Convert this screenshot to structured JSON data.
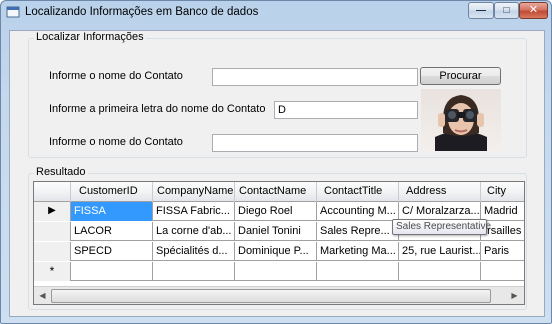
{
  "window": {
    "title": "Localizando Informações em Banco de dados",
    "minimize_glyph": "—",
    "maximize_glyph": "□",
    "close_glyph": "✕"
  },
  "search_group": {
    "legend": "Localizar Informações",
    "label_contact_name": "Informe o nome do Contato",
    "contact_name_value": "",
    "label_first_letter": "Informe a primeira letra do nome do Contato",
    "first_letter_value": "D",
    "label_contact_name_2": "Informe o nome do Contato",
    "contact_name_2_value": "",
    "search_button": "Procurar",
    "photo_icon": "person-binoculars-icon"
  },
  "result_group": {
    "legend": "Resultado",
    "columns": [
      "CustomerID",
      "CompanyName",
      "ContactName",
      "ContactTitle",
      "Address",
      "City"
    ],
    "rows": [
      [
        "FISSA",
        "FISSA Fabric...",
        "Diego Roel",
        "Accounting M...",
        "C/ Moralzarza...",
        "Madrid"
      ],
      [
        "LACOR",
        "La corne d'ab...",
        "Daniel Tonini",
        "Sales Repre...",
        "",
        "ersailles"
      ],
      [
        "SPECD",
        "Spécialités d...",
        "Dominique P...",
        "Marketing Ma...",
        "25, rue Laurist...",
        "Paris"
      ]
    ],
    "current_row_indicator": "▶",
    "new_row_indicator": "*",
    "tooltip": "Sales Representative",
    "scroll_left": "◀",
    "scroll_right": "▶"
  }
}
